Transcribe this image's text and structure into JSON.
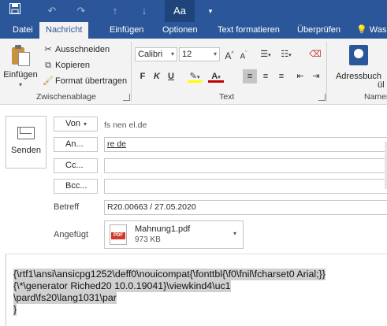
{
  "quick_access": {
    "format_label": "Aa"
  },
  "tabs": [
    "Datei",
    "Nachricht",
    "Einfügen",
    "Optionen",
    "Text formatieren",
    "Überprüfen",
    "Was"
  ],
  "active_tab": "Nachricht",
  "ribbon": {
    "clipboard": {
      "paste_label": "Einfügen",
      "cut_label": "Ausschneiden",
      "copy_label": "Kopieren",
      "format_painter_label": "Format übertragen",
      "group_label": "Zwischenablage"
    },
    "text": {
      "font_name": "Calibri",
      "font_size": "12",
      "grow_font": "A",
      "shrink_font": "A",
      "bold": "F",
      "italic": "K",
      "underline": "U",
      "group_label": "Text"
    },
    "names": {
      "address_book_label": "Adressbuch",
      "group_label": "Namen",
      "cut_off_label": "ül"
    }
  },
  "message": {
    "send_label": "Senden",
    "from_label": "Von",
    "from_value": "fs              nen              el.de",
    "to_label": "An...",
    "to_value": "re                                            de",
    "cc_label": "Cc...",
    "bcc_label": "Bcc...",
    "subject_label": "Betreff",
    "subject_value": "R20.00663 / 27.05.2020",
    "attached_label": "Angefügt",
    "attachment": {
      "name": "Mahnung1.pdf",
      "size": "973 KB",
      "icon_text": "PDF"
    }
  },
  "body_lines": [
    "{\\rtf1\\ansi\\ansicpg1252\\deff0\\nouicompat{\\fonttbl{\\f0\\fnil\\fcharset0 Arial;}}",
    "{\\*\\generator Riched20 10.0.19041}\\viewkind4\\uc1",
    "\\pard\\fs20\\lang1031\\par",
    "}"
  ],
  "colors": {
    "brand_blue": "#2b579a",
    "ribbon_bg": "#f3f3f3",
    "highlight_yellow": "#ffff00",
    "font_red": "#c00000",
    "selection_gray": "#d0d0d0"
  }
}
